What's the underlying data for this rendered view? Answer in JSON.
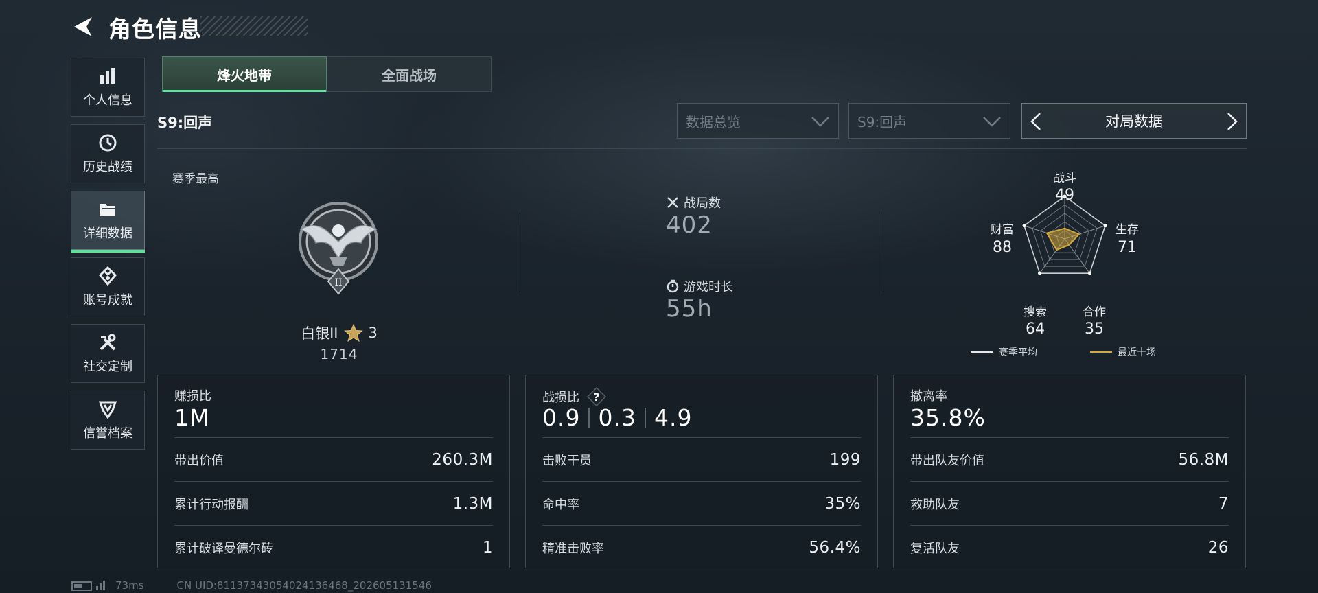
{
  "header": {
    "title": "角色信息"
  },
  "sidebar": {
    "items": [
      {
        "label": "个人信息"
      },
      {
        "label": "历史战绩"
      },
      {
        "label": "详细数据"
      },
      {
        "label": "账号成就"
      },
      {
        "label": "社交定制"
      },
      {
        "label": "信誉档案"
      }
    ],
    "active_index": 2
  },
  "tabs": [
    {
      "label": "烽火地带"
    },
    {
      "label": "全面战场"
    }
  ],
  "season": {
    "label": "S9:回声"
  },
  "filters": {
    "overview": {
      "value": "数据总览"
    },
    "season": {
      "value": "S9:回声"
    },
    "nav": {
      "label": "对局数据"
    }
  },
  "summary": {
    "season_best_label": "赛季最高",
    "rank": {
      "name": "白银II",
      "stars": "3",
      "points": "1714"
    },
    "matches": {
      "label": "战局数",
      "value": "402"
    },
    "playtime": {
      "label": "游戏时长",
      "value": "55h"
    }
  },
  "radar": {
    "axes": [
      {
        "label": "战斗",
        "value": "49"
      },
      {
        "label": "生存",
        "value": "71"
      },
      {
        "label": "合作",
        "value": "35"
      },
      {
        "label": "搜索",
        "value": "64"
      },
      {
        "label": "财富",
        "value": "88"
      }
    ],
    "legend": {
      "season_avg": "赛季平均",
      "recent_ten": "最近十场"
    },
    "colors": {
      "season_avg": "#e6e6e6",
      "recent_ten": "#d4a83c"
    }
  },
  "panels": {
    "profit": {
      "title": "赚损比",
      "value": "1M",
      "rows": [
        {
          "label": "带出价值",
          "value": "260.3M"
        },
        {
          "label": "累计行动报酬",
          "value": "1.3M"
        },
        {
          "label": "累计破译曼德尔砖",
          "value": "1"
        }
      ]
    },
    "kd": {
      "title": "战损比",
      "values": [
        "0.9",
        "0.3",
        "4.9"
      ],
      "rows": [
        {
          "label": "击败干员",
          "value": "199"
        },
        {
          "label": "命中率",
          "value": "35%"
        },
        {
          "label": "精准击败率",
          "value": "56.4%"
        }
      ]
    },
    "extract": {
      "title": "撤离率",
      "value": "35.8%",
      "rows": [
        {
          "label": "带出队友价值",
          "value": "56.8M"
        },
        {
          "label": "救助队友",
          "value": "7"
        },
        {
          "label": "复活队友",
          "value": "26"
        }
      ]
    }
  },
  "footer": {
    "ping": "73ms",
    "uid": "CN UID:8113734305402413646​8_202605131546"
  },
  "colors": {
    "accent": "#5fe39c",
    "gold": "#d4a83c"
  }
}
